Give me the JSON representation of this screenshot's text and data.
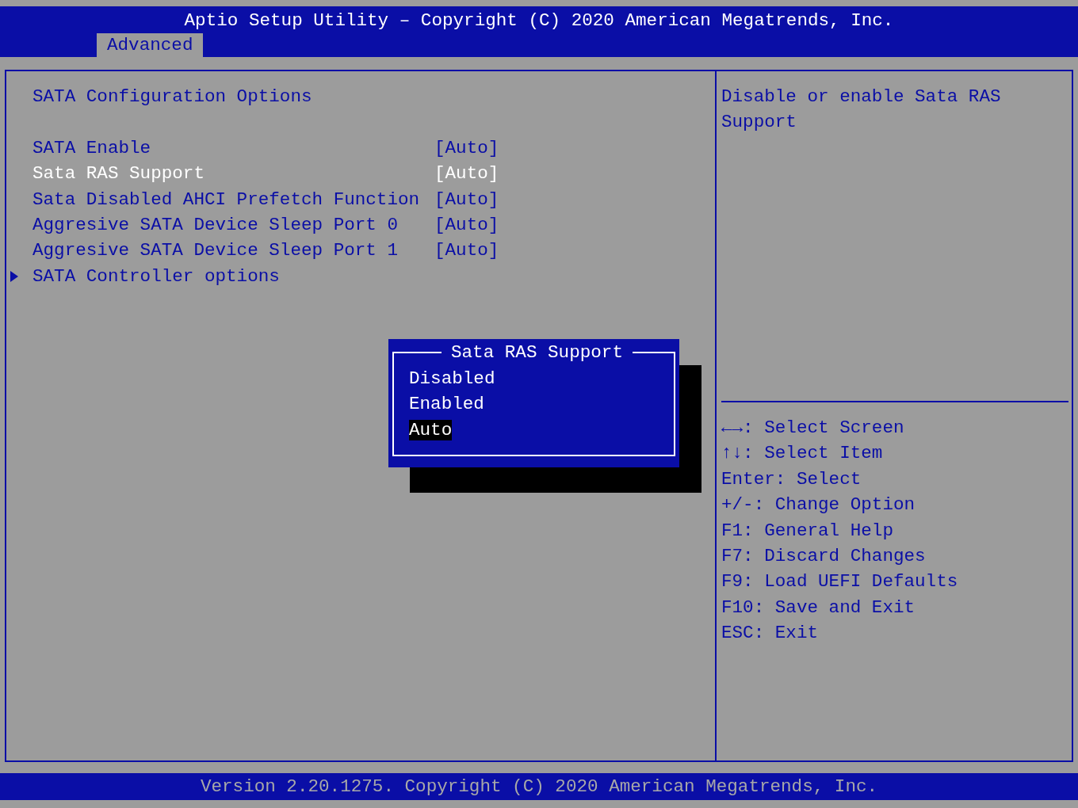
{
  "header": {
    "title": "Aptio Setup Utility – Copyright (C) 2020 American Megatrends, Inc.",
    "tabs": [
      {
        "label": "Advanced",
        "selected": true
      }
    ]
  },
  "main": {
    "heading": "SATA Configuration Options",
    "items": [
      {
        "kind": "setting",
        "label": "SATA Enable",
        "value": "[Auto]",
        "selected": false
      },
      {
        "kind": "setting",
        "label": "Sata RAS Support",
        "value": "[Auto]",
        "selected": true
      },
      {
        "kind": "setting",
        "label": "Sata Disabled AHCI Prefetch Function",
        "value": "[Auto]",
        "selected": false
      },
      {
        "kind": "setting",
        "label": "Aggresive SATA Device Sleep Port 0",
        "value": "[Auto]",
        "selected": false
      },
      {
        "kind": "setting",
        "label": "Aggresive SATA Device Sleep Port 1",
        "value": "[Auto]",
        "selected": false
      },
      {
        "kind": "submenu",
        "label": "SATA Controller options",
        "selected": false
      }
    ]
  },
  "popup": {
    "title": "Sata RAS Support",
    "options": [
      {
        "label": "Disabled",
        "selected": false
      },
      {
        "label": "Enabled",
        "selected": false
      },
      {
        "label": "Auto",
        "selected": true
      }
    ]
  },
  "help": {
    "text": "Disable or enable Sata RAS Support",
    "keys": [
      "←→: Select Screen",
      "↑↓: Select Item",
      "Enter: Select",
      "+/-: Change Option",
      "F1: General Help",
      "F7: Discard Changes",
      "F9: Load UEFI Defaults",
      "F10: Save and Exit",
      "ESC: Exit"
    ]
  },
  "footer": {
    "text": "Version 2.20.1275. Copyright (C) 2020 American Megatrends, Inc."
  }
}
